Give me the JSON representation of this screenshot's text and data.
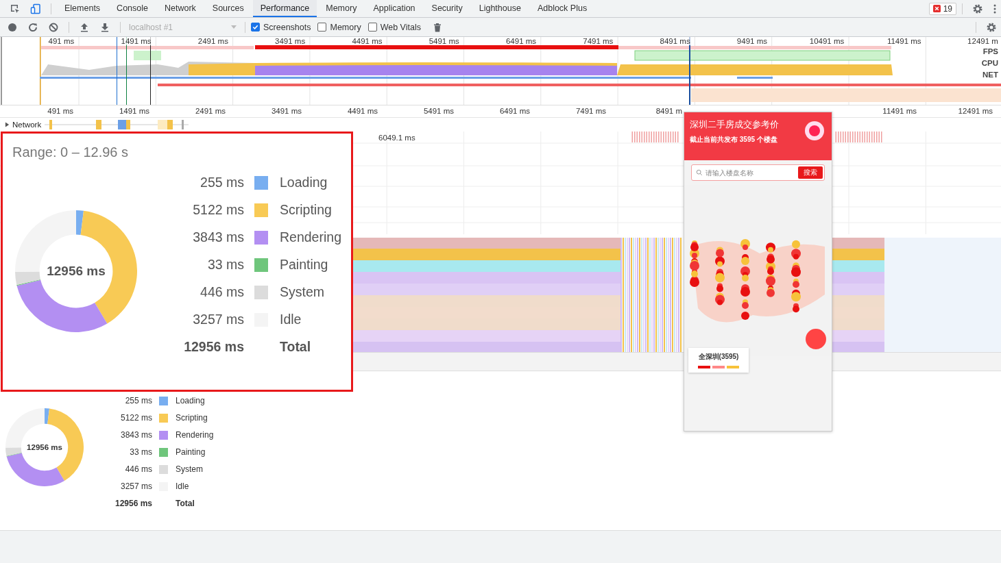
{
  "tabs": [
    {
      "label": "Elements",
      "selected": false
    },
    {
      "label": "Console",
      "selected": false
    },
    {
      "label": "Network",
      "selected": false
    },
    {
      "label": "Sources",
      "selected": false
    },
    {
      "label": "Performance",
      "selected": true
    },
    {
      "label": "Memory",
      "selected": false
    },
    {
      "label": "Application",
      "selected": false
    },
    {
      "label": "Security",
      "selected": false
    },
    {
      "label": "Lighthouse",
      "selected": false
    },
    {
      "label": "Adblock Plus",
      "selected": false
    }
  ],
  "error_badge": "19",
  "toolbar": {
    "target": {
      "label": "localhost #1",
      "disabled": true
    },
    "options": [
      {
        "label": "Screenshots",
        "checked": true
      },
      {
        "label": "Memory",
        "checked": false
      },
      {
        "label": "Web Vitals",
        "checked": false
      }
    ]
  },
  "overview": {
    "ticks": [
      "491 ms",
      "1491 ms",
      "2491 ms",
      "3491 ms",
      "4491 ms",
      "5491 ms",
      "6491 ms",
      "7491 ms",
      "8491 ms",
      "9491 ms",
      "10491 ms",
      "11491 ms",
      "12491 m"
    ],
    "tracks": [
      "FPS",
      "CPU",
      "NET"
    ]
  },
  "ruler": {
    "ticks_left": [
      "491 ms",
      "1491 ms",
      "2491 ms",
      "3491 ms",
      "4491 ms",
      "5491 ms",
      "6491 ms",
      "7491 ms",
      "8491 m"
    ],
    "ticks_right": [
      "11491 ms",
      "12491 ms"
    ]
  },
  "network_track": {
    "label": "Network",
    "expanded": false
  },
  "flame_chart": {
    "marker": "6049.1 ms"
  },
  "screenshot": {
    "title": "深圳二手房成交参考价",
    "subtitle": "截止当前共发布 3595 个楼盘",
    "search_placeholder": "请输入楼盘名称",
    "search_button": "搜索",
    "area_label": "全深圳(3595)"
  },
  "summary_zoom": {
    "range": "Range: 0 – 12.96 s",
    "total_center": "12956 ms",
    "chart_data": {
      "type": "donut",
      "categories": [
        "Loading",
        "Scripting",
        "Rendering",
        "Painting",
        "System",
        "Idle"
      ],
      "values": [
        1.97,
        39.53,
        29.66,
        0.25,
        3.44,
        25.15
      ]
    },
    "items": [
      {
        "value": "255 ms",
        "color": "#78aef0"
      },
      {
        "value": "5122 ms",
        "color": "#f8ca55"
      },
      {
        "value": "3843 ms",
        "color": "#b38ff2"
      },
      {
        "value": "33 ms",
        "color": "#6fc67c"
      },
      {
        "value": "446 ms",
        "color": "#dcdcdc"
      },
      {
        "value": "3257 ms",
        "color": "#f4f4f4"
      }
    ],
    "total": {
      "value": "12956 ms",
      "label": "Total"
    }
  },
  "summary": {
    "total_center": "12956 ms",
    "chart_data": {
      "type": "donut",
      "categories": [
        "Loading",
        "Scripting",
        "Rendering",
        "Painting",
        "System",
        "Idle"
      ],
      "values": [
        1.97,
        39.53,
        29.66,
        0.25,
        3.44,
        25.15
      ]
    },
    "items": [
      {
        "value": "255 ms",
        "color": "#78aef0"
      },
      {
        "value": "5122 ms",
        "color": "#f8ca55"
      },
      {
        "value": "3843 ms",
        "color": "#b38ff2"
      },
      {
        "value": "33 ms",
        "color": "#6fc67c"
      },
      {
        "value": "446 ms",
        "color": "#dcdcdc"
      },
      {
        "value": "3257 ms",
        "color": "#f4f4f4"
      }
    ],
    "total": {
      "value": "12956 ms",
      "label": "Total"
    }
  }
}
